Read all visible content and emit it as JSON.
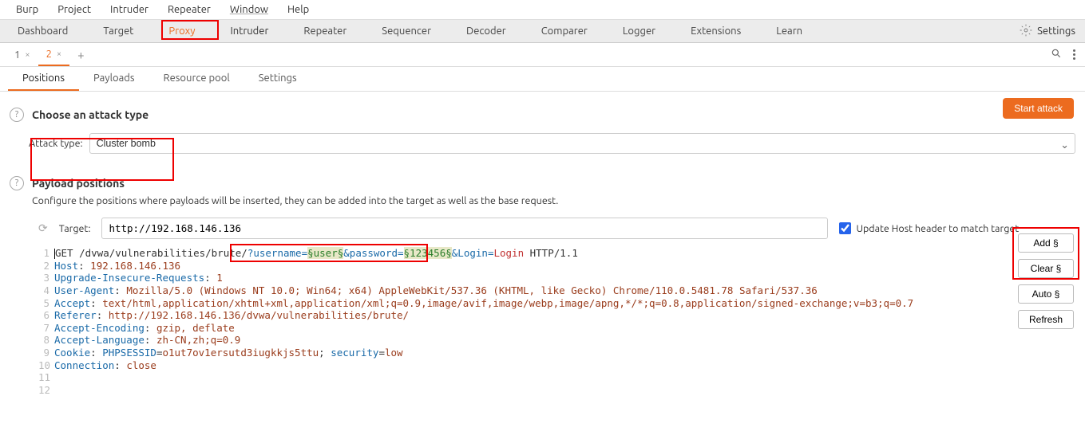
{
  "menubar": {
    "items": [
      "Burp",
      "Project",
      "Intruder",
      "Repeater",
      "Window",
      "Help"
    ]
  },
  "maintabs": {
    "items": [
      "Dashboard",
      "Target",
      "Proxy",
      "Intruder",
      "Repeater",
      "Sequencer",
      "Decoder",
      "Comparer",
      "Logger",
      "Extensions",
      "Learn"
    ],
    "active_orange": "Proxy",
    "highlighted": "Intruder",
    "settings_label": "Settings"
  },
  "numtabs": {
    "items": [
      {
        "label": "1"
      },
      {
        "label": "2"
      }
    ],
    "active": "2"
  },
  "subtabs": {
    "items": [
      "Positions",
      "Payloads",
      "Resource pool",
      "Settings"
    ],
    "active": "Positions"
  },
  "attack": {
    "section_title": "Choose an attack type",
    "label": "Attack type:",
    "value": "Cluster bomb",
    "start_button": "Start attack"
  },
  "payload": {
    "section_title": "Payload positions",
    "description": "Configure the positions where payloads will be inserted, they can be added into the target as well as the base request.",
    "target_label": "Target:",
    "target_value": "http://192.168.146.136",
    "update_host_label": "Update Host header to match target",
    "update_host_checked": true
  },
  "code": {
    "line1_pre": "GET /dvwa/vulnerabilities/brute/",
    "line1_q_prefix": "?",
    "line1_username_k": "username",
    "line1_username_v": "§user§",
    "line1_amp": "&",
    "line1_password_k": "password",
    "line1_password_v": "§123456§",
    "line1_amp2": "&",
    "line1_login_k": "Login",
    "line1_login_v": "Login",
    "line1_suffix": " HTTP/1.1",
    "line2_k": "Host",
    "line2_v": "192.168.146.136",
    "line3_k": "Upgrade-Insecure-Requests",
    "line3_v": "1",
    "line4_k": "User-Agent",
    "line4_v": "Mozilla/5.0 (Windows NT 10.0; Win64; x64) AppleWebKit/537.36 (KHTML, like Gecko) Chrome/110.0.5481.78 Safari/537.36",
    "line5_k": "Accept",
    "line5_v": "text/html,application/xhtml+xml,application/xml;q=0.9,image/avif,image/webp,image/apng,*/*;q=0.8,application/signed-exchange;v=b3;q=0.7",
    "line6_k": "Referer",
    "line6_v": "http://192.168.146.136/dvwa/vulnerabilities/brute/",
    "line7_k": "Accept-Encoding",
    "line7_v": "gzip, deflate",
    "line8_k": "Accept-Language",
    "line8_v": "zh-CN,zh;q=0.9",
    "line9_k": "Cookie",
    "line9_v1": "PHPSESSID",
    "line9_v2": "o1ut7ov1ersutd3iugkkjs5ttu",
    "line9_v3": "security",
    "line9_v4": "low",
    "line10_k": "Connection",
    "line10_v": "close"
  },
  "sidebuttons": {
    "add": "Add §",
    "clear": "Clear §",
    "auto": "Auto §",
    "refresh": "Refresh"
  },
  "linenums": [
    "1",
    "2",
    "3",
    "4",
    "5",
    "6",
    "7",
    "8",
    "9",
    "10",
    "11",
    "12"
  ]
}
